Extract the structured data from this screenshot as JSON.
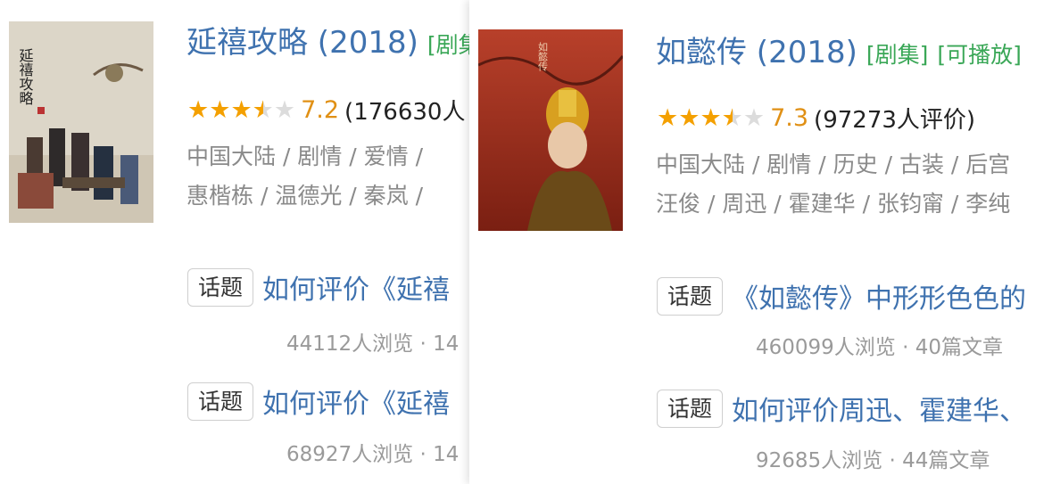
{
  "left": {
    "title": "延禧攻略 (2018)",
    "tags": [
      "[剧集"
    ],
    "rating": {
      "stars": 3.5,
      "score": "7.2",
      "count": "(176630人"
    },
    "meta_line1": "中国大陆 / 剧情 / 爱情 / ",
    "meta_line2": "惠楷栋 / 温德光 / 秦岚 / ",
    "topics": [
      {
        "tag": "话题",
        "title": "如何评价《延禧",
        "stats": "44112人浏览 · 14"
      },
      {
        "tag": "话题",
        "title": "如何评价《延禧",
        "stats": "68927人浏览 · 14"
      }
    ],
    "poster_text": "延禧攻略"
  },
  "right": {
    "title": "如懿传 (2018)",
    "tags": [
      "[剧集]",
      "[可播放]"
    ],
    "rating": {
      "stars": 3.5,
      "score": "7.3",
      "count": "(97273人评价)"
    },
    "meta_line1": "中国大陆 / 剧情 / 历史 / 古装 / 后宫",
    "meta_line2": "汪俊 / 周迅 / 霍建华 / 张钧甯 / 李纯",
    "topics": [
      {
        "tag": "话题",
        "title": "《如懿传》中形形色色的",
        "stats": "460099人浏览 · 40篇文章"
      },
      {
        "tag": "话题",
        "title": "如何评价周迅、霍建华、",
        "stats": "92685人浏览 · 44篇文章"
      }
    ],
    "poster_text": "如懿传"
  },
  "colors": {
    "link": "#3f72af",
    "tag_green": "#3aa757",
    "star": "#f4a000",
    "score": "#e09015"
  }
}
